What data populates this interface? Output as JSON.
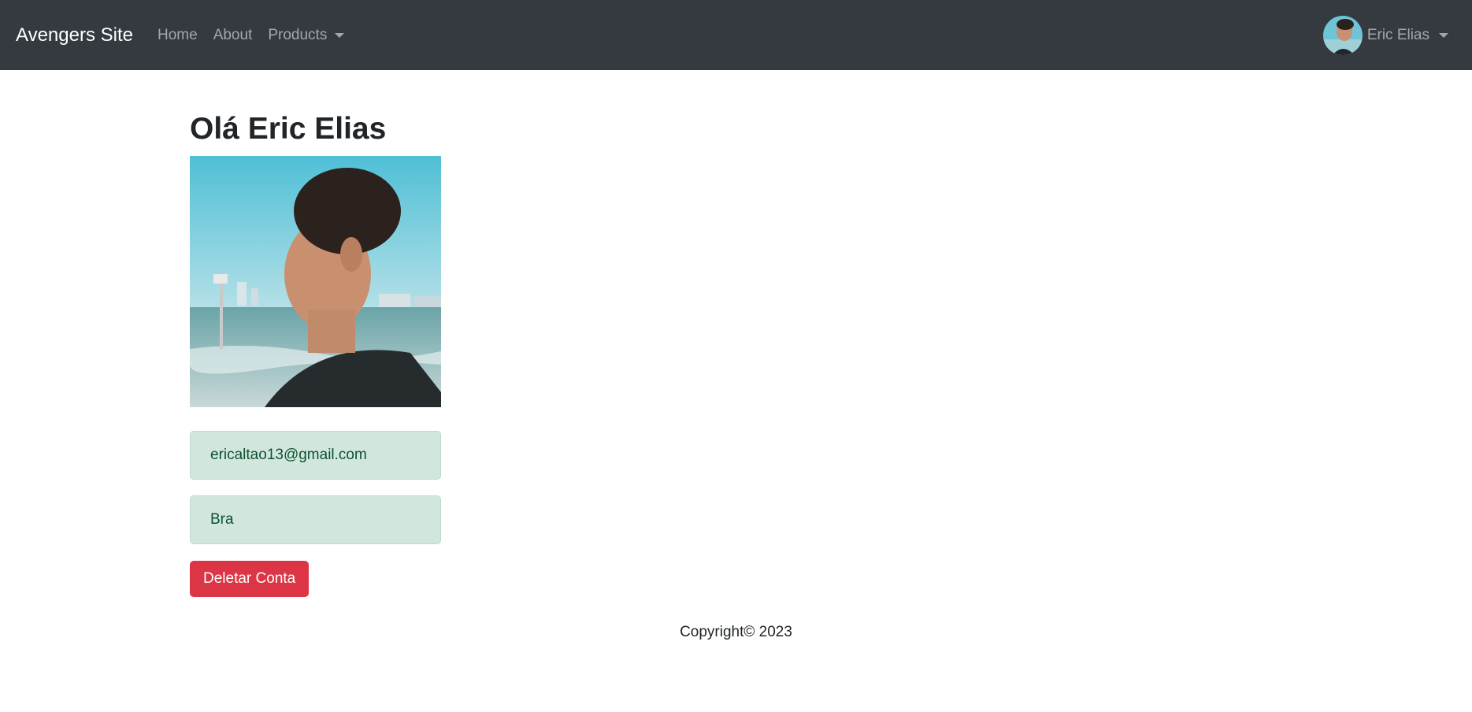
{
  "navbar": {
    "brand": "Avengers Site",
    "links": [
      {
        "label": "Home"
      },
      {
        "label": "About"
      },
      {
        "label": "Products"
      }
    ],
    "user": {
      "name": "Eric Elias"
    }
  },
  "profile": {
    "greeting": "Olá Eric Elias",
    "email": "ericaltao13@gmail.com",
    "country": "Bra",
    "delete_label": "Deletar Conta"
  },
  "footer": {
    "text": "Copyright© 2023"
  },
  "colors": {
    "navbar_bg": "#343a40",
    "success_bg": "#d1e7dd",
    "success_text": "#0f5132",
    "danger": "#dc3545"
  }
}
